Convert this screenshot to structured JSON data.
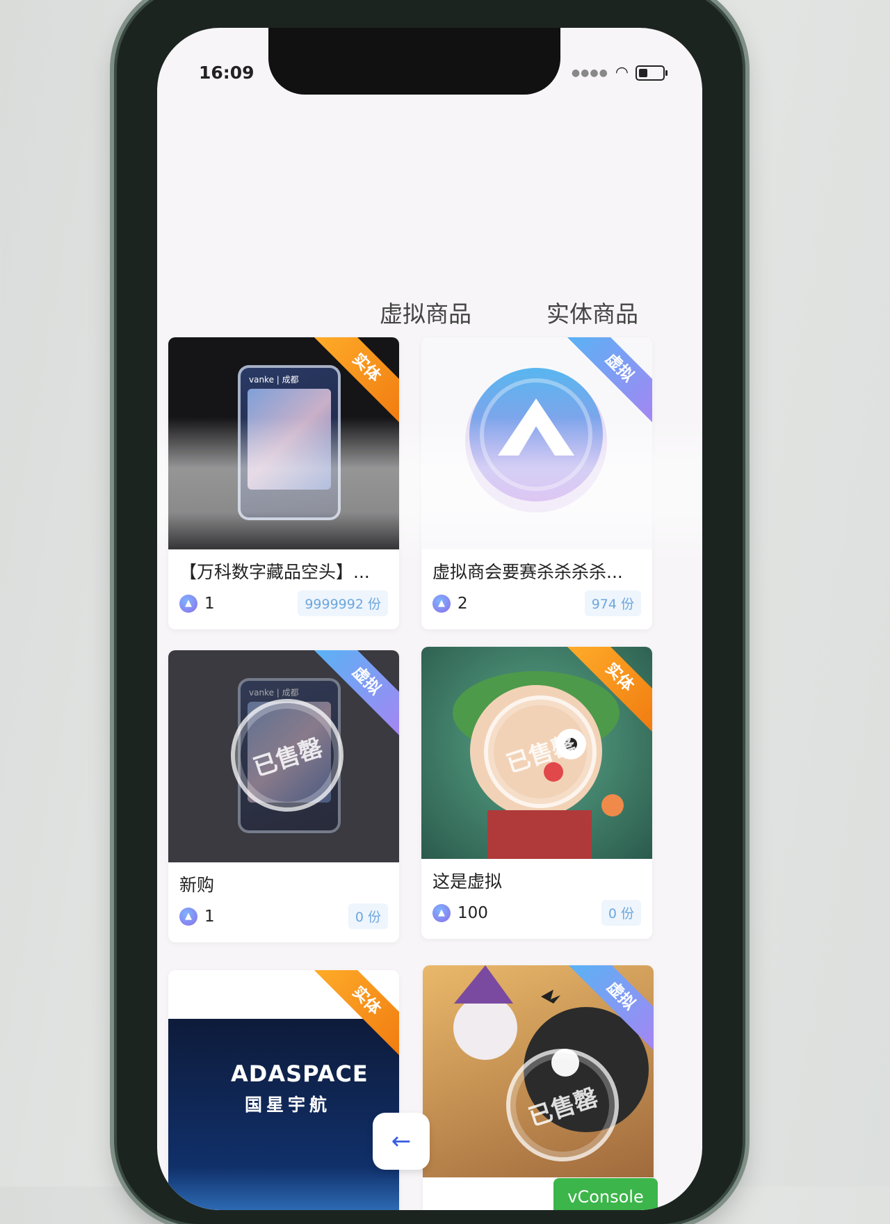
{
  "status_bar": {
    "time": "16:09"
  },
  "tabs": [
    {
      "label": "虚拟商品"
    },
    {
      "label": "实体商品"
    }
  ],
  "products": [
    {
      "title": "【万科数字藏品空头】...",
      "price": "1",
      "stock": "9999992 份",
      "tag": "实体",
      "tag_color": "#f08a18",
      "brand_text": "vanke | 成都"
    },
    {
      "title": "虚拟商会要赛杀杀杀杀...",
      "price": "2",
      "stock": "974 份",
      "tag": "虚拟",
      "tag_color": "#6aa9f2"
    },
    {
      "title": "新购",
      "price": "1",
      "stock": "0 份",
      "tag": "虚拟",
      "tag_color": "#6aa9f2",
      "sold_label": "已售罄",
      "brand_text": "vanke | 成都"
    },
    {
      "title": "这是虚拟",
      "price": "100",
      "stock": "0 份",
      "tag": "实体",
      "tag_color": "#f08a18",
      "sold_label": "已售罄"
    },
    {
      "title": "",
      "price": "",
      "stock": "",
      "tag": "实体",
      "tag_color": "#f08a18",
      "logo_text": "ADASPACE",
      "logo_sub": "国星宇航"
    },
    {
      "title": "",
      "price": "",
      "stock": "",
      "tag": "虚拟",
      "tag_color": "#6aa9f2",
      "sold_label": "已售罄"
    }
  ],
  "floating": {
    "back_icon": "arrow-left-icon",
    "vconsole_label": "vConsole"
  }
}
